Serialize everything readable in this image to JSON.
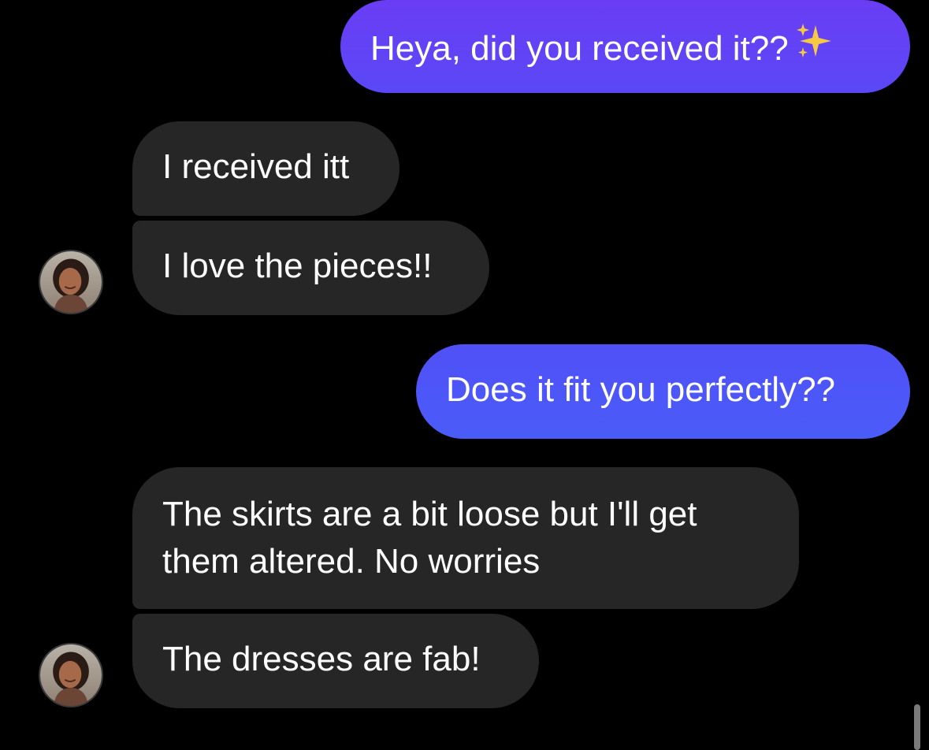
{
  "colors": {
    "background": "#000000",
    "received_bubble": "#262626",
    "sent_gradient_top": "#6b3cf5",
    "sent_gradient_bottom": "#4c5cf8",
    "text": "#ffffff"
  },
  "messages": [
    {
      "id": "m1",
      "direction": "sent",
      "text": "Heya, did you received it??",
      "emoji": "sparkles-icon"
    },
    {
      "id": "m2",
      "direction": "received",
      "text": "I received itt"
    },
    {
      "id": "m3",
      "direction": "received",
      "text": "I love the pieces!!",
      "avatar": "contact-avatar"
    },
    {
      "id": "m4",
      "direction": "sent",
      "text": "Does it fit you perfectly??"
    },
    {
      "id": "m5",
      "direction": "received",
      "text": "The skirts are a bit loose but I'll get them altered. No worries"
    },
    {
      "id": "m6",
      "direction": "received",
      "text": "The dresses are fab!",
      "avatar": "contact-avatar"
    }
  ]
}
